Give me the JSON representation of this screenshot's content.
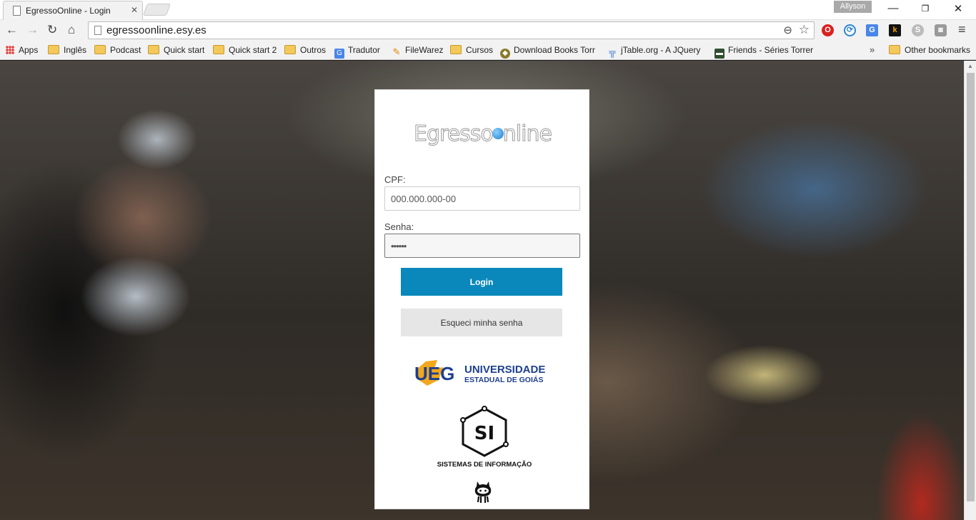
{
  "browser": {
    "tab_title": "EgressoOnline - Login",
    "tab_close": "✕",
    "user_name": "Allyson",
    "window": {
      "minimize": "—",
      "maximize": "❐",
      "close": "✕"
    },
    "nav": {
      "back": "←",
      "forward": "→",
      "reload": "↻",
      "home": "⌂"
    },
    "url": "egressoonline.esy.es",
    "zoom_glyph": "⊖",
    "star_glyph": "☆",
    "extensions": [
      {
        "name": "opera-vpn-icon",
        "glyph": "O"
      },
      {
        "name": "sync-icon",
        "glyph": "⟳"
      },
      {
        "name": "google-translate-icon",
        "glyph": "G"
      },
      {
        "name": "k-extension-icon",
        "glyph": "k"
      },
      {
        "name": "skype-icon",
        "glyph": "S"
      },
      {
        "name": "camera-icon",
        "glyph": "◙"
      }
    ],
    "menu_glyph": "≡",
    "bookmarks": {
      "apps": "Apps",
      "items": [
        "Inglês",
        "Podcast",
        "Quick start",
        "Quick start 2",
        "Outros",
        "Tradutor",
        "FileWarez",
        "Cursos",
        "Download Books Torr",
        "jTable.org - A JQuery",
        "Friends - Séries Torrer"
      ],
      "overflow": "»",
      "other": "Other bookmarks"
    }
  },
  "page": {
    "brand": {
      "part1": "Egresso",
      "part2": "nline"
    },
    "form": {
      "cpf_label": "CPF:",
      "cpf_placeholder": "000.000.000-00",
      "senha_label": "Senha:",
      "senha_value": "••••••",
      "login_button": "Login",
      "forgot_button": "Esqueci minha senha"
    },
    "logos": {
      "ueg_line1": "UNIVERSIDADE",
      "ueg_line2": "ESTADUAL DE GOIÁS",
      "ueg_mark": "UEG",
      "si_mark": "SI",
      "si_caption": "SISTEMAS DE INFORMAÇÃO"
    }
  }
}
